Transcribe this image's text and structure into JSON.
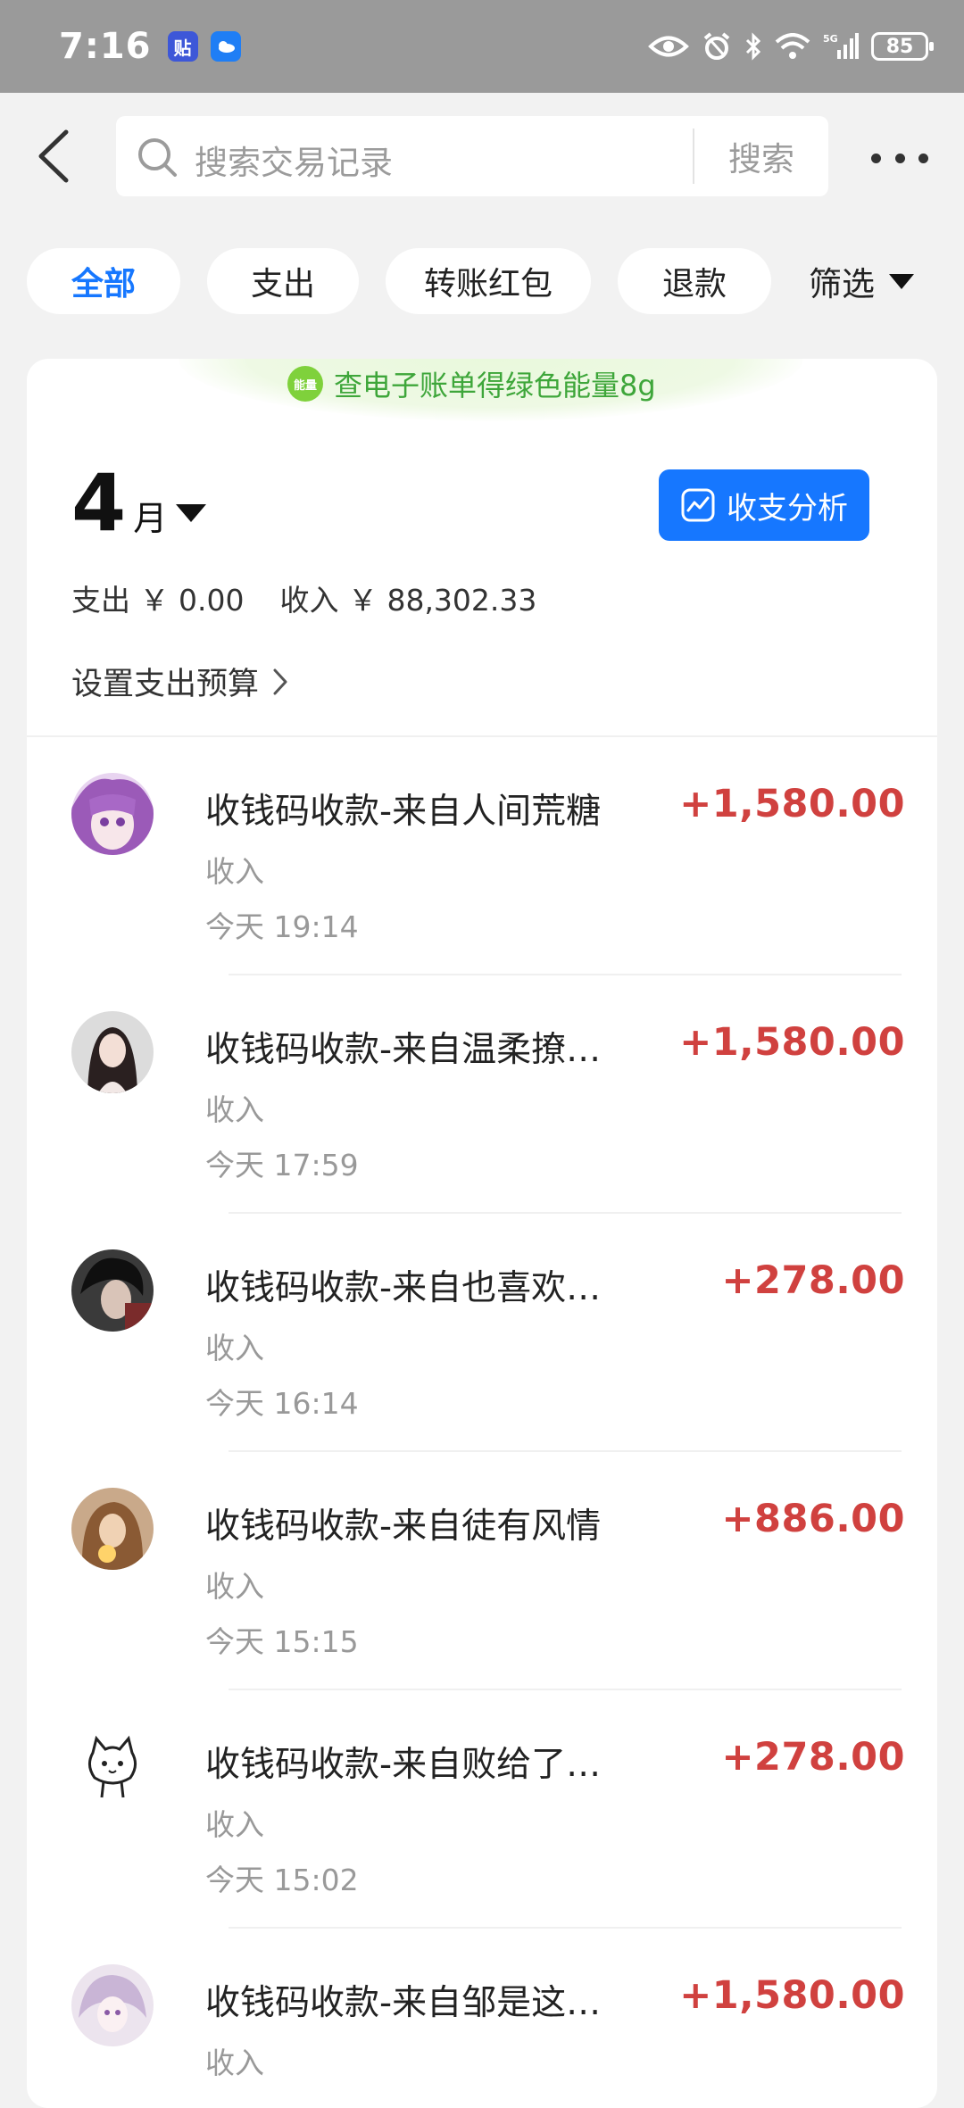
{
  "status_bar": {
    "time": "7:16",
    "app_badge_1": "贴",
    "battery": "85",
    "network": "5G"
  },
  "header": {
    "search_placeholder": "搜索交易记录",
    "search_button": "搜索"
  },
  "tabs": [
    {
      "label": "全部",
      "active": true
    },
    {
      "label": "支出",
      "active": false
    },
    {
      "label": "转账红包",
      "active": false
    },
    {
      "label": "退款",
      "active": false
    }
  ],
  "filter_label": "筛选",
  "eco_banner": {
    "icon_text": "能量",
    "text": "查电子账单得绿色能量8g"
  },
  "month": {
    "number": "4",
    "unit": "月"
  },
  "analysis_button": "收支分析",
  "summary": {
    "expense": "支出 ￥ 0.00",
    "income": "收入 ￥ 88,302.33"
  },
  "budget_link": "设置支出预算",
  "transactions": [
    {
      "title": "收钱码收款-来自人间荒糖",
      "type": "收入",
      "time": "今天 19:14",
      "amount": "+1,580.00"
    },
    {
      "title": "收钱码收款-来自温柔撩…",
      "type": "收入",
      "time": "今天 17:59",
      "amount": "+1,580.00"
    },
    {
      "title": "收钱码收款-来自也喜欢…",
      "type": "收入",
      "time": "今天 16:14",
      "amount": "+278.00"
    },
    {
      "title": "收钱码收款-来自徒有风情",
      "type": "收入",
      "time": "今天 15:15",
      "amount": "+886.00"
    },
    {
      "title": "收钱码收款-来自败给了…",
      "type": "收入",
      "time": "今天 15:02",
      "amount": "+278.00"
    },
    {
      "title": "收钱码收款-来自邹是这…",
      "type": "收入",
      "time": "",
      "amount": "+1,580.00"
    }
  ],
  "colors": {
    "accent": "#1677ff",
    "income_amount": "#d0413f",
    "eco_green": "#3ea63a"
  }
}
